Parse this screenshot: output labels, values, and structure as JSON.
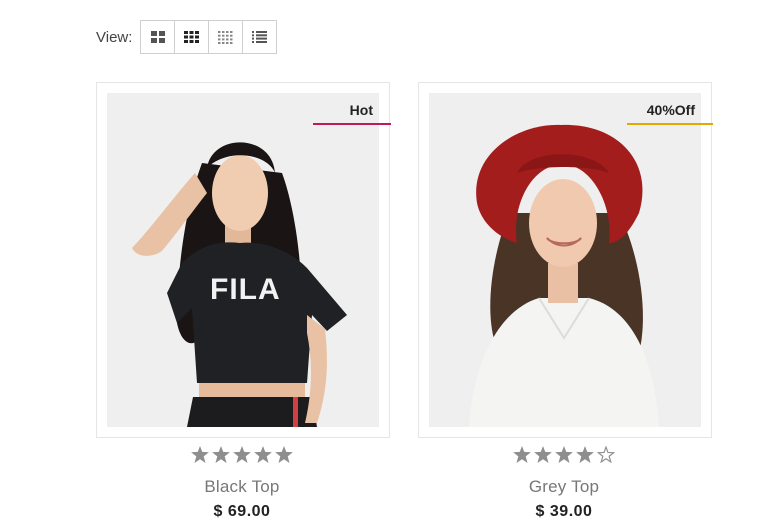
{
  "toolbar": {
    "view_label": "View:",
    "view_options": [
      {
        "icon": "grid-2-icon"
      },
      {
        "icon": "grid-3-icon"
      },
      {
        "icon": "grid-4-icon"
      },
      {
        "icon": "list-icon"
      }
    ]
  },
  "products": [
    {
      "badge": "Hot",
      "badge_color": "#c2185b",
      "name": "Black Top",
      "price": "$ 69.00",
      "rating": 5,
      "rating_max": 5
    },
    {
      "badge": "40%Off",
      "badge_color": "#e0a800",
      "name": "Grey Top",
      "price": "$ 39.00",
      "rating": 4,
      "rating_max": 5
    }
  ],
  "colors": {
    "star_filled": "#8e8e8e",
    "image_bg": "#efeff0"
  }
}
